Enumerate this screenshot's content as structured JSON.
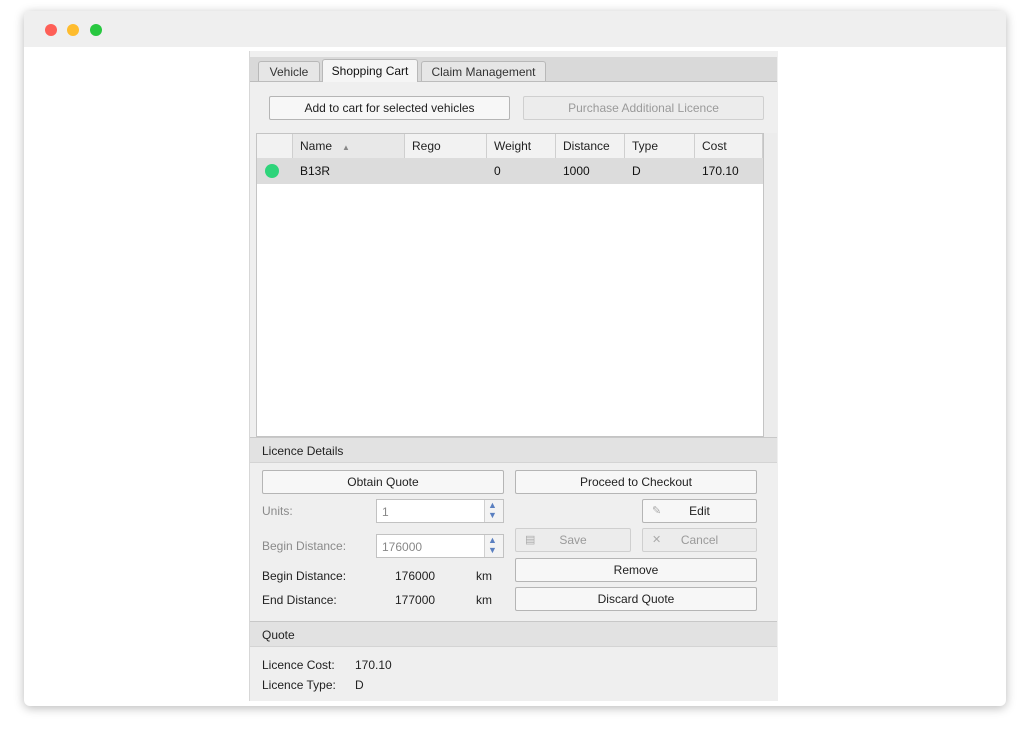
{
  "tabs": [
    {
      "label": "Vehicle",
      "active": false
    },
    {
      "label": "Shopping Cart",
      "active": true
    },
    {
      "label": "Claim Management",
      "active": false
    }
  ],
  "toolbar": {
    "add_to_cart_label": "Add to cart for selected vehicles",
    "purchase_licence_label": "Purchase Additional Licence"
  },
  "table": {
    "columns": [
      "Name",
      "Rego",
      "Weight",
      "Distance",
      "Type",
      "Cost"
    ],
    "sort_column": "Name",
    "rows": [
      {
        "status": "active",
        "status_color": "#2ed47a",
        "name": "B13R",
        "rego": "",
        "weight": "0",
        "distance": "1000",
        "type": "D",
        "cost": "170.10"
      }
    ]
  },
  "licence_details": {
    "header": "Licence Details",
    "obtain_quote_label": "Obtain Quote",
    "proceed_checkout_label": "Proceed to Checkout",
    "edit_label": "Edit",
    "save_label": "Save",
    "cancel_label": "Cancel",
    "remove_label": "Remove",
    "discard_quote_label": "Discard Quote",
    "units_label": "Units:",
    "units_value": "1",
    "begin_distance_input_label": "Begin Distance:",
    "begin_distance_input_value": "176000",
    "begin_distance_label": "Begin Distance:",
    "begin_distance_value": "176000",
    "begin_distance_unit": "km",
    "end_distance_label": "End Distance:",
    "end_distance_value": "177000",
    "end_distance_unit": "km"
  },
  "quote": {
    "header": "Quote",
    "licence_cost_label": "Licence Cost:",
    "licence_cost_value": "170.10",
    "licence_type_label": "Licence Type:",
    "licence_type_value": "D"
  },
  "colors": {
    "status_active": "#2ed47a",
    "window_close": "#fe5f57",
    "window_minimize": "#febc2e",
    "window_zoom": "#28c840"
  }
}
